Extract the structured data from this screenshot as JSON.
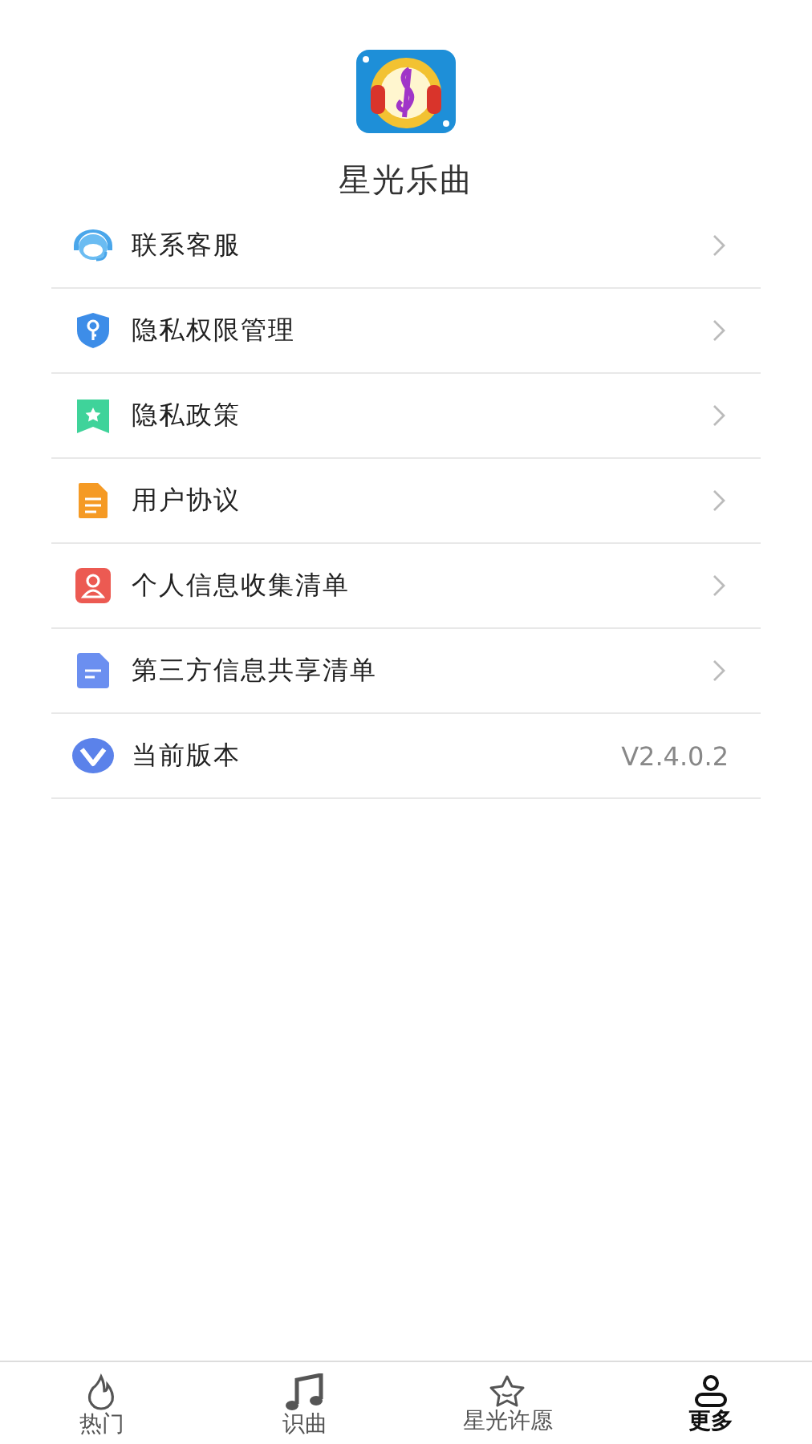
{
  "app": {
    "name": "星光乐曲"
  },
  "menu": [
    {
      "kind": "link",
      "label": "联系客服"
    },
    {
      "kind": "link",
      "label": "隐私权限管理"
    },
    {
      "kind": "link",
      "label": "隐私政策"
    },
    {
      "kind": "link",
      "label": "用户协议"
    },
    {
      "kind": "link",
      "label": "个人信息收集清单"
    },
    {
      "kind": "link",
      "label": "第三方信息共享清单"
    },
    {
      "kind": "version",
      "label": "当前版本",
      "value": "V2.4.0.2"
    }
  ],
  "tab_bar": [
    {
      "label": "热门",
      "selected": false
    },
    {
      "label": "识曲",
      "selected": false
    },
    {
      "label": "星光许愿",
      "selected": false
    },
    {
      "label": "更多",
      "selected": true
    }
  ]
}
